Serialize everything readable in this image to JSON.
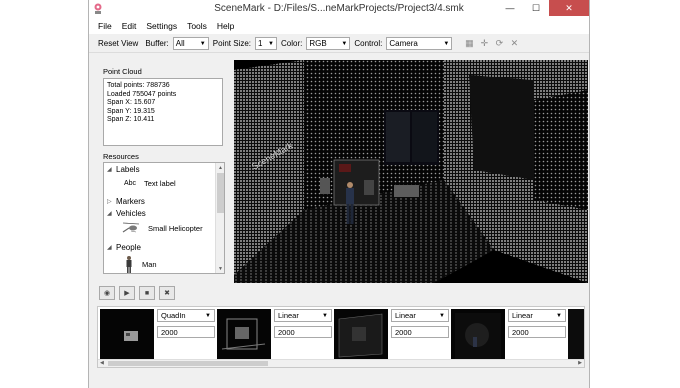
{
  "window": {
    "title": "SceneMark - D:/Files/S...neMarkProjects/Project3/4.smk",
    "controls": {
      "minimize": "—",
      "maximize": "☐",
      "close": "✕"
    }
  },
  "menu": {
    "items": [
      "File",
      "Edit",
      "Settings",
      "Tools",
      "Help"
    ]
  },
  "toolbar": {
    "reset_view": "Reset View",
    "buffer_label": "Buffer:",
    "buffer_value": "All",
    "point_size_label": "Point Size:",
    "point_size_value": "1",
    "color_label": "Color:",
    "color_value": "RGB",
    "control_label": "Control:",
    "control_value": "Camera",
    "icons": [
      "grid-icon",
      "move-icon",
      "rotate-icon",
      "delete-icon"
    ]
  },
  "point_cloud": {
    "label": "Point Cloud",
    "lines": [
      "Total points: 788736",
      "Loaded 755047 points",
      "Span X: 15.607",
      "Span Y: 19.315",
      "Span Z: 10.411"
    ]
  },
  "resources": {
    "label": "Resources",
    "groups": {
      "labels": "Labels",
      "markers": "Markers",
      "vehicles": "Vehicles",
      "people": "People"
    },
    "items": {
      "text_label": "Text label",
      "text_label_icon": "Abc",
      "helicopter": "Small Helicopter",
      "man": "Man"
    }
  },
  "timeline": {
    "transitions": [
      {
        "ease": "QuadIn",
        "duration": "2000"
      },
      {
        "ease": "Linear",
        "duration": "2000"
      },
      {
        "ease": "Linear",
        "duration": "2000"
      },
      {
        "ease": "Linear",
        "duration": "2000"
      }
    ]
  },
  "colors": {
    "close_button": "#c74e4e",
    "window_bg": "#f0f0f0"
  }
}
